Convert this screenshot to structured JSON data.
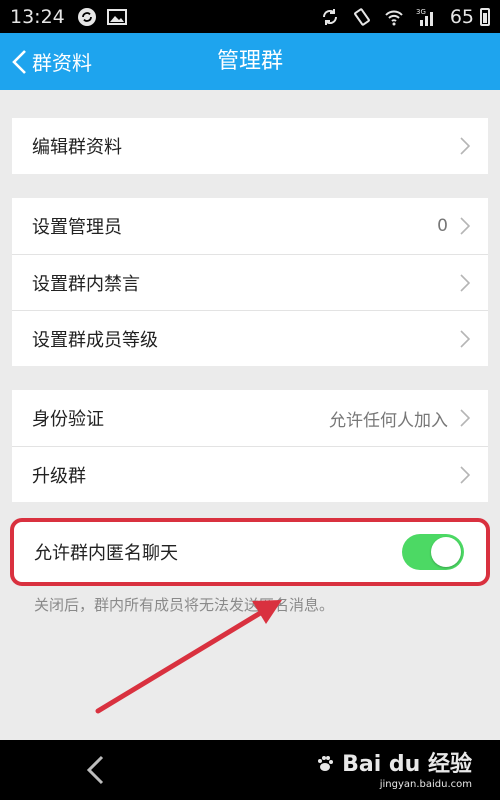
{
  "status_bar": {
    "time": "13:24",
    "battery": "65",
    "network": "3G"
  },
  "header": {
    "back_label": "群资料",
    "title": "管理群"
  },
  "sections": {
    "edit": {
      "label": "编辑群资料"
    },
    "admins": {
      "label": "设置管理员",
      "value": "0"
    },
    "mute": {
      "label": "设置群内禁言"
    },
    "levels": {
      "label": "设置群成员等级"
    },
    "verify": {
      "label": "身份验证",
      "value": "允许任何人加入"
    },
    "upgrade": {
      "label": "升级群"
    },
    "anonymous": {
      "label": "允许群内匿名聊天",
      "enabled": true
    }
  },
  "hint": "关闭后，群内所有成员将无法发送匿名消息。",
  "watermark": {
    "brand": "Bai du 经验",
    "url": "jingyan.baidu.com"
  },
  "colors": {
    "title_bar": "#1ea4ee",
    "toggle_on": "#4cd964",
    "highlight": "#d9313f"
  }
}
